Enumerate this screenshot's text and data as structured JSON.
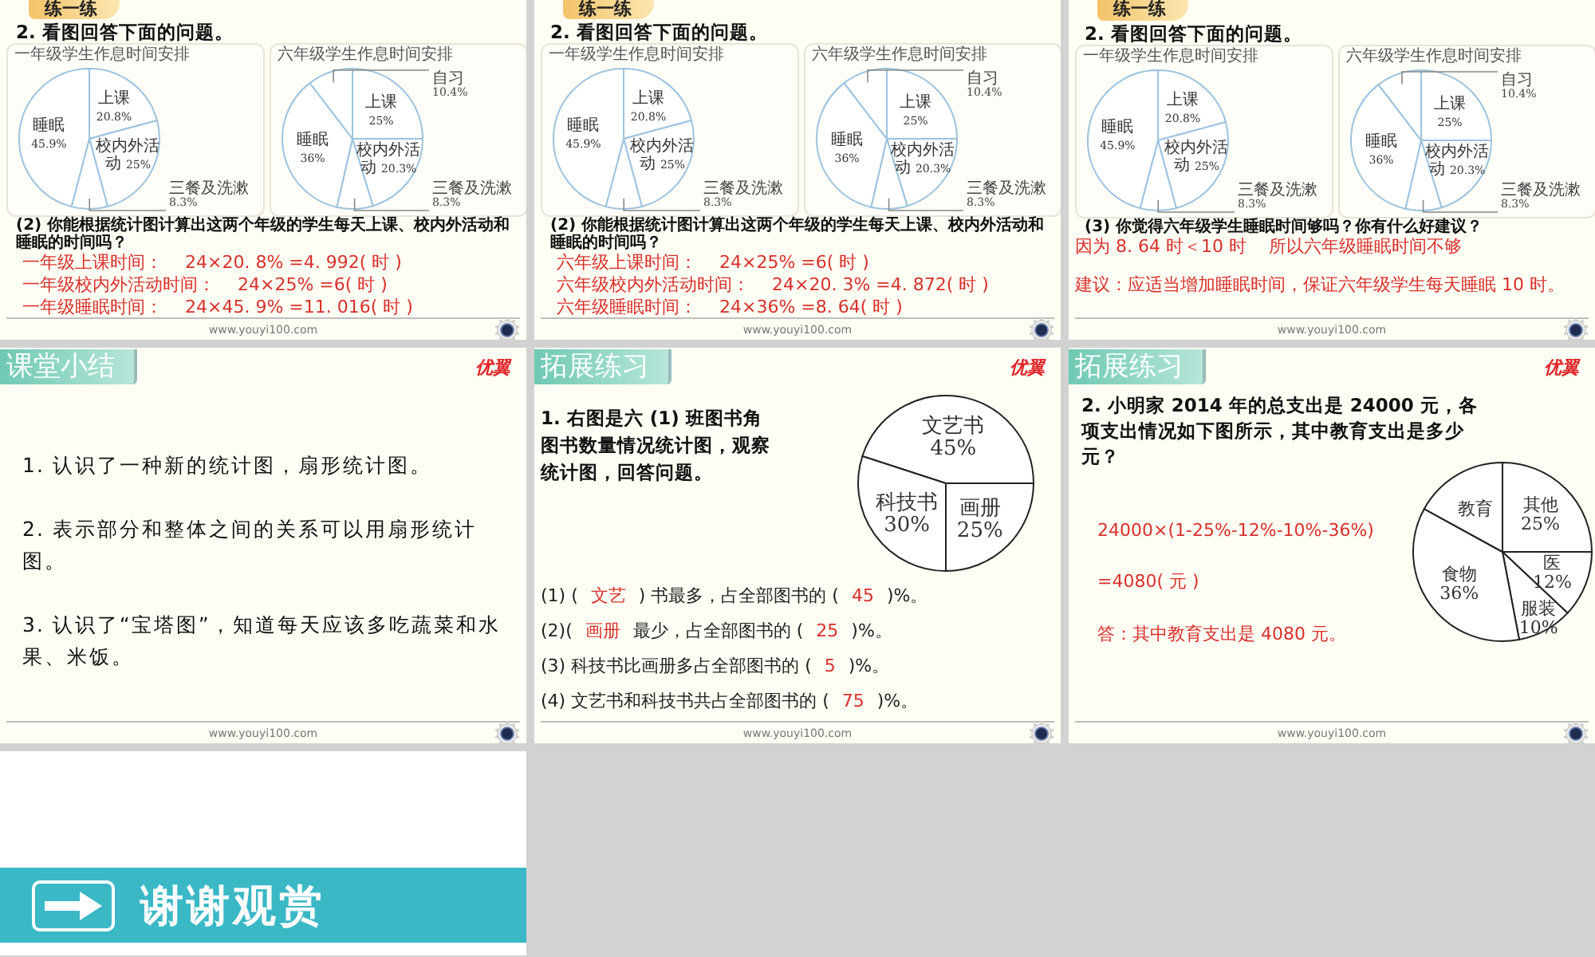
{
  "slides": [
    {
      "kind": "practice",
      "tab": "练一练",
      "question": "2. 看图回答下面的问题。",
      "charts": [
        {
          "title": "一年级学生作息时间安排",
          "chart_data": {
            "type": "pie",
            "categories": [
              "上课",
              "校内外活动",
              "三餐及洗漱",
              "睡眠"
            ],
            "values": [
              20.8,
              25,
              8.3,
              45.9
            ],
            "value_labels": [
              "20.8%",
              "25%",
              "8.3%",
              "45.9%"
            ]
          }
        },
        {
          "title": "六年级学生作息时间安排",
          "chart_data": {
            "type": "pie",
            "categories": [
              "上课",
              "校内外活动",
              "三餐及洗漱",
              "睡眠",
              "自习"
            ],
            "values": [
              25,
              20.3,
              8.3,
              36,
              10.4
            ],
            "value_labels": [
              "25%",
              "20.3%",
              "8.3%",
              "36%",
              "10.4%"
            ]
          }
        }
      ],
      "prompt": "(2) 你能根据统计图计算出这两个年级的学生每天上课、校内外活动和睡眠的时间吗？",
      "answers": [
        {
          "parts": [
            "一年级上课时间：",
            "24×20. 8% =4. 992( 时 )"
          ]
        },
        {
          "parts": [
            "一年级校内外活动时间：",
            "24×25%  =6( 时 )"
          ]
        },
        {
          "parts": [
            "一年级睡眠时间：",
            "24×45. 9% =11. 016( 时 )"
          ]
        }
      ],
      "footer": "www.youyi100.com"
    },
    {
      "kind": "practice",
      "tab": "练一练",
      "question": "2. 看图回答下面的问题。",
      "charts": [
        {
          "title": "一年级学生作息时间安排",
          "chart_data": {
            "type": "pie",
            "categories": [
              "上课",
              "校内外活动",
              "三餐及洗漱",
              "睡眠"
            ],
            "values": [
              20.8,
              25,
              8.3,
              45.9
            ],
            "value_labels": [
              "20.8%",
              "25%",
              "8.3%",
              "45.9%"
            ]
          }
        },
        {
          "title": "六年级学生作息时间安排",
          "chart_data": {
            "type": "pie",
            "categories": [
              "上课",
              "校内外活动",
              "三餐及洗漱",
              "睡眠",
              "自习"
            ],
            "values": [
              25,
              20.3,
              8.3,
              36,
              10.4
            ],
            "value_labels": [
              "25%",
              "20.3%",
              "8.3%",
              "36%",
              "10.4%"
            ]
          }
        }
      ],
      "prompt": "(2) 你能根据统计图计算出这两个年级的学生每天上课、校内外活动和睡眠的时间吗？",
      "answers": [
        {
          "parts": [
            "六年级上课时间：",
            "24×25%  =6( 时 )"
          ]
        },
        {
          "parts": [
            "六年级校内外活动时间：",
            "24×20. 3% =4. 872( 时 )"
          ]
        },
        {
          "parts": [
            "六年级睡眠时间：",
            "24×36% =8. 64( 时 )"
          ]
        }
      ],
      "footer": "www.youyi100.com"
    },
    {
      "kind": "practice",
      "tab": "练一练",
      "question": "2. 看图回答下面的问题。",
      "charts": [
        {
          "title": "一年级学生作息时间安排",
          "chart_data": {
            "type": "pie",
            "categories": [
              "上课",
              "校内外活动",
              "三餐及洗漱",
              "睡眠"
            ],
            "values": [
              20.8,
              25,
              8.3,
              45.9
            ],
            "value_labels": [
              "20.8%",
              "25%",
              "8.3%",
              "45.9%"
            ]
          }
        },
        {
          "title": "六年级学生作息时间安排",
          "chart_data": {
            "type": "pie",
            "categories": [
              "上课",
              "校内外活动",
              "三餐及洗漱",
              "睡眠",
              "自习"
            ],
            "values": [
              25,
              20.3,
              8.3,
              36,
              10.4
            ],
            "value_labels": [
              "25%",
              "20.3%",
              "8.3%",
              "36%",
              "10.4%"
            ]
          }
        }
      ],
      "prompt": "(3) 你觉得六年级学生睡眠时间够吗？你有什么好建议？",
      "answers": [
        {
          "parts": [
            "因为 8. 64 时＜10 时",
            "所以六年级睡眠时间不够"
          ]
        },
        {
          "parts": [
            "建议：应适当增加睡眠时间，保证六年级学生每天睡眠 10 时。"
          ]
        }
      ],
      "footer": "www.youyi100.com"
    },
    {
      "kind": "summary",
      "tab": "课堂小结",
      "logo": "优翼",
      "items": [
        "1. 认识了一种新的统计图，扇形统计图。",
        "2. 表示部分和整体之间的关系可以用扇形统计图。",
        "3. 认识了“宝塔图”，知道每天应该多吃蔬菜和水果、米饭。"
      ],
      "footer": "www.youyi100.com"
    },
    {
      "kind": "exercise",
      "tab": "拓展练习",
      "logo": "优翼",
      "question": "1. 右图是六 (1) 班图书角图书数量情况统计图，观察统计图，回答问题。",
      "chart_data": {
        "type": "pie",
        "categories": [
          "文艺书",
          "画册",
          "科技书"
        ],
        "values": [
          45,
          25,
          30
        ],
        "value_labels": [
          "45%",
          "25%",
          "30%"
        ]
      },
      "lines": [
        {
          "parts": [
            {
              "kind": "plain",
              "text": "(1) ("
            },
            {
              "kind": "answer",
              "text": "文艺"
            },
            {
              "kind": "plain",
              "text": ") 书最多，占全部图书的 ("
            },
            {
              "kind": "answer",
              "text": "45"
            },
            {
              "kind": "plain",
              "text": ")%。"
            }
          ]
        },
        {
          "parts": [
            {
              "kind": "plain",
              "text": "(2)("
            },
            {
              "kind": "answer",
              "text": "画册"
            },
            {
              "kind": "plain",
              "text": "最少，占全部图书的 ("
            },
            {
              "kind": "answer",
              "text": "25"
            },
            {
              "kind": "plain",
              "text": ")%。"
            }
          ]
        },
        {
          "parts": [
            {
              "kind": "plain",
              "text": "(3) 科技书比画册多占全部图书的 ("
            },
            {
              "kind": "answer",
              "text": "5"
            },
            {
              "kind": "plain",
              "text": ")%。"
            }
          ]
        },
        {
          "parts": [
            {
              "kind": "plain",
              "text": "(4) 文艺书和科技书共占全部图书的 ("
            },
            {
              "kind": "answer",
              "text": "75"
            },
            {
              "kind": "plain",
              "text": ")%。"
            }
          ]
        }
      ],
      "footer": "www.youyi100.com"
    },
    {
      "kind": "solution",
      "tab": "拓展练习",
      "logo": "优翼",
      "question": "2.  小明家 2014 年的总支出是 24000 元，各项支出情况如下图所示，其中教育支出是多少元？",
      "chart_data": {
        "type": "pie",
        "categories": [
          "其他",
          "医",
          "服装",
          "食物",
          "教育"
        ],
        "values": [
          25,
          12,
          10,
          36,
          17
        ],
        "value_labels": [
          "25%",
          "12%",
          "10%",
          "36%",
          null
        ]
      },
      "lines": [
        "24000×(1-25%-12%-10%-36%)",
        "=4080( 元 )",
        "答：其中教育支出是 4080 元。"
      ],
      "footer": "www.youyi100.com"
    },
    {
      "kind": "ending",
      "title": "谢谢观赏"
    }
  ]
}
